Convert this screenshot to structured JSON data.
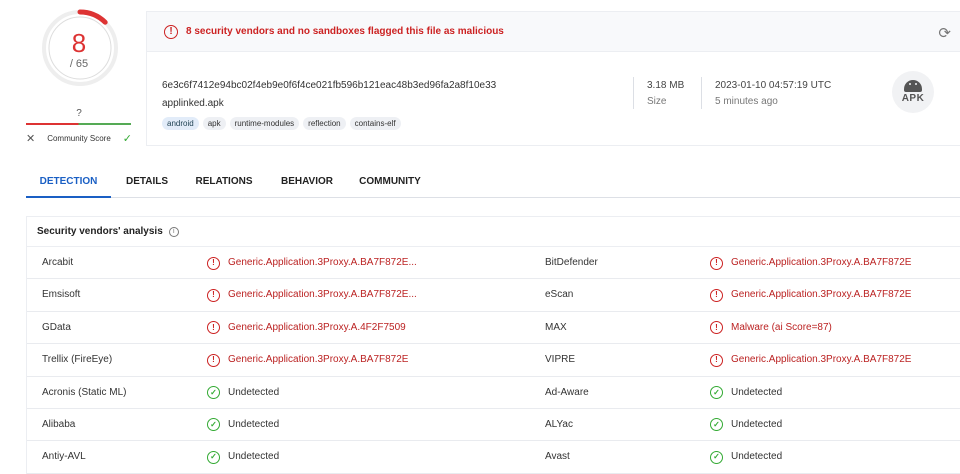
{
  "score": {
    "detections": "8",
    "total": "/ 65",
    "community_value": "?",
    "community_label": "Community Score",
    "community_down": "✕",
    "community_up": "✓",
    "malicious_fraction": 0.123
  },
  "alert": {
    "icon": "alert-circle-icon",
    "text": "8 security vendors and no sandboxes flagged this file as malicious"
  },
  "file": {
    "hash": "6e3c6f7412e94bc02f4eb9e0f6f4ce021fb596b121eac48b3ed96fa2a8f10e33",
    "name": "applinked.apk",
    "tags": [
      "android",
      "apk",
      "runtime-modules",
      "reflection",
      "contains-elf"
    ],
    "size_value": "3.18 MB",
    "size_label": "Size",
    "date_value": "2023-01-10 04:57:19 UTC",
    "date_label": "5 minutes ago",
    "type_badge": "APK"
  },
  "tabs": [
    {
      "label": "DETECTION",
      "active": true
    },
    {
      "label": "DETAILS"
    },
    {
      "label": "RELATIONS"
    },
    {
      "label": "BEHAVIOR"
    },
    {
      "label": "COMMUNITY"
    }
  ],
  "analysis": {
    "title": "Security vendors' analysis",
    "rows": [
      {
        "v1": "Arcabit",
        "r1": "Generic.Application.3Proxy.A.BA7F872E...",
        "s1": "bad",
        "v2": "BitDefender",
        "r2": "Generic.Application.3Proxy.A.BA7F872E",
        "s2": "bad"
      },
      {
        "v1": "Emsisoft",
        "r1": "Generic.Application.3Proxy.A.BA7F872E...",
        "s1": "bad",
        "v2": "eScan",
        "r2": "Generic.Application.3Proxy.A.BA7F872E",
        "s2": "bad"
      },
      {
        "v1": "GData",
        "r1": "Generic.Application.3Proxy.A.4F2F7509",
        "s1": "bad",
        "v2": "MAX",
        "r2": "Malware (ai Score=87)",
        "s2": "bad"
      },
      {
        "v1": "Trellix (FireEye)",
        "r1": "Generic.Application.3Proxy.A.BA7F872E",
        "s1": "bad",
        "v2": "VIPRE",
        "r2": "Generic.Application.3Proxy.A.BA7F872E",
        "s2": "bad"
      },
      {
        "v1": "Acronis (Static ML)",
        "r1": "Undetected",
        "s1": "ok",
        "v2": "Ad-Aware",
        "r2": "Undetected",
        "s2": "ok"
      },
      {
        "v1": "Alibaba",
        "r1": "Undetected",
        "s1": "ok",
        "v2": "ALYac",
        "r2": "Undetected",
        "s2": "ok"
      },
      {
        "v1": "Antiy-AVL",
        "r1": "Undetected",
        "s1": "ok",
        "v2": "Avast",
        "r2": "Undetected",
        "s2": "ok"
      }
    ]
  },
  "colors": {
    "malicious": "#cc2222",
    "clean": "#33aa33",
    "accent": "#1a5fc4"
  }
}
